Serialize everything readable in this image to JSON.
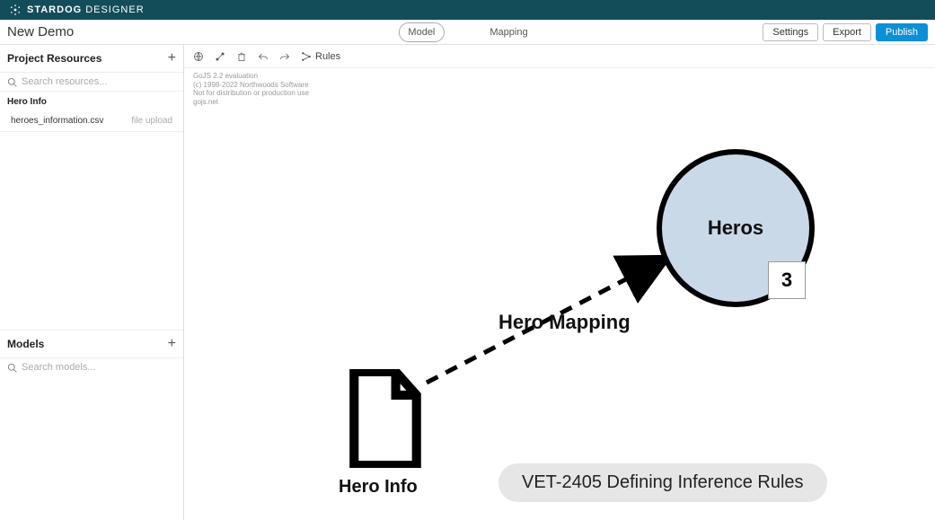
{
  "app": {
    "brand_bold": "STARDOG",
    "brand_light": "DESIGNER"
  },
  "subbar": {
    "title": "New Demo",
    "tab_model": "Model",
    "tab_mapping": "Mapping",
    "btn_settings": "Settings",
    "btn_export": "Export",
    "btn_publish": "Publish"
  },
  "sidebar": {
    "resources_header": "Project Resources",
    "search_resources_placeholder": "Search resources...",
    "group_label": "Hero Info",
    "file_name": "heroes_information.csv",
    "file_meta": "file upload",
    "models_header": "Models",
    "search_models_placeholder": "Search models..."
  },
  "toolbar": {
    "rules_label": "Rules"
  },
  "watermark": {
    "l1": "GoJS 2.2 evaluation",
    "l2": "(c) 1998-2022 Northwoods Software",
    "l3": "Not for distribution or production use",
    "l4": "gojs.net"
  },
  "canvas": {
    "circle_label": "Heros",
    "badge_value": "3",
    "file_caption": "Hero Info",
    "edge_label": "Hero Mapping"
  },
  "ticket": {
    "text": "VET-2405 Defining Inference Rules"
  }
}
